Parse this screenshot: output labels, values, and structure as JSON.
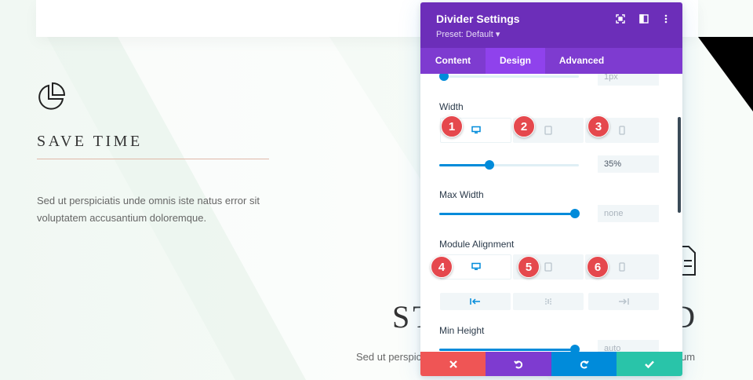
{
  "background": {
    "feature": {
      "title": "SAVE TIME",
      "description": "Sed ut perspiciatis unde omnis iste natus error sit voluptatem accusantium doloremque."
    },
    "heading_left": "ST",
    "heading_right": "D",
    "desc_left": "Sed ut perspic",
    "desc_right": "um",
    "desc_right_line2": "",
    "icons": [
      "pie-chart-icon",
      "document-icon"
    ]
  },
  "panel": {
    "title": "Divider Settings",
    "preset": "Preset: Default ▾",
    "header_icons": [
      "focus-icon",
      "sidebar-icon",
      "more-vertical-icon"
    ],
    "tabs": [
      "Content",
      "Design",
      "Advanced"
    ],
    "active_tab": "Design",
    "top_value": "1px",
    "width": {
      "label": "Width",
      "value": "35%",
      "slider_fraction": 0.35,
      "devices": [
        "desktop",
        "tablet",
        "phone"
      ]
    },
    "max_width": {
      "label": "Max Width",
      "value": "none",
      "slider_fraction": 1.0
    },
    "module_alignment": {
      "label": "Module Alignment",
      "devices": [
        "desktop",
        "tablet",
        "phone"
      ],
      "options": [
        "align-left",
        "align-center",
        "align-right"
      ],
      "selected": "align-left"
    },
    "min_height": {
      "label": "Min Height",
      "value": "auto",
      "slider_fraction": 1.0
    },
    "badges": [
      "1",
      "2",
      "3",
      "4",
      "5",
      "6"
    ],
    "footer": {
      "buttons": [
        "cancel",
        "undo",
        "redo",
        "save"
      ],
      "colors": {
        "cancel": "#ef5555",
        "undo": "#7e3bd0",
        "redo": "#008bda",
        "save": "#29c4a9"
      }
    }
  },
  "colors": {
    "header": "#6c2eb9",
    "tabs": "#7e3bd0",
    "active_tab": "#8f42ec",
    "accent": "#008bda",
    "badge": "#e5484d"
  }
}
